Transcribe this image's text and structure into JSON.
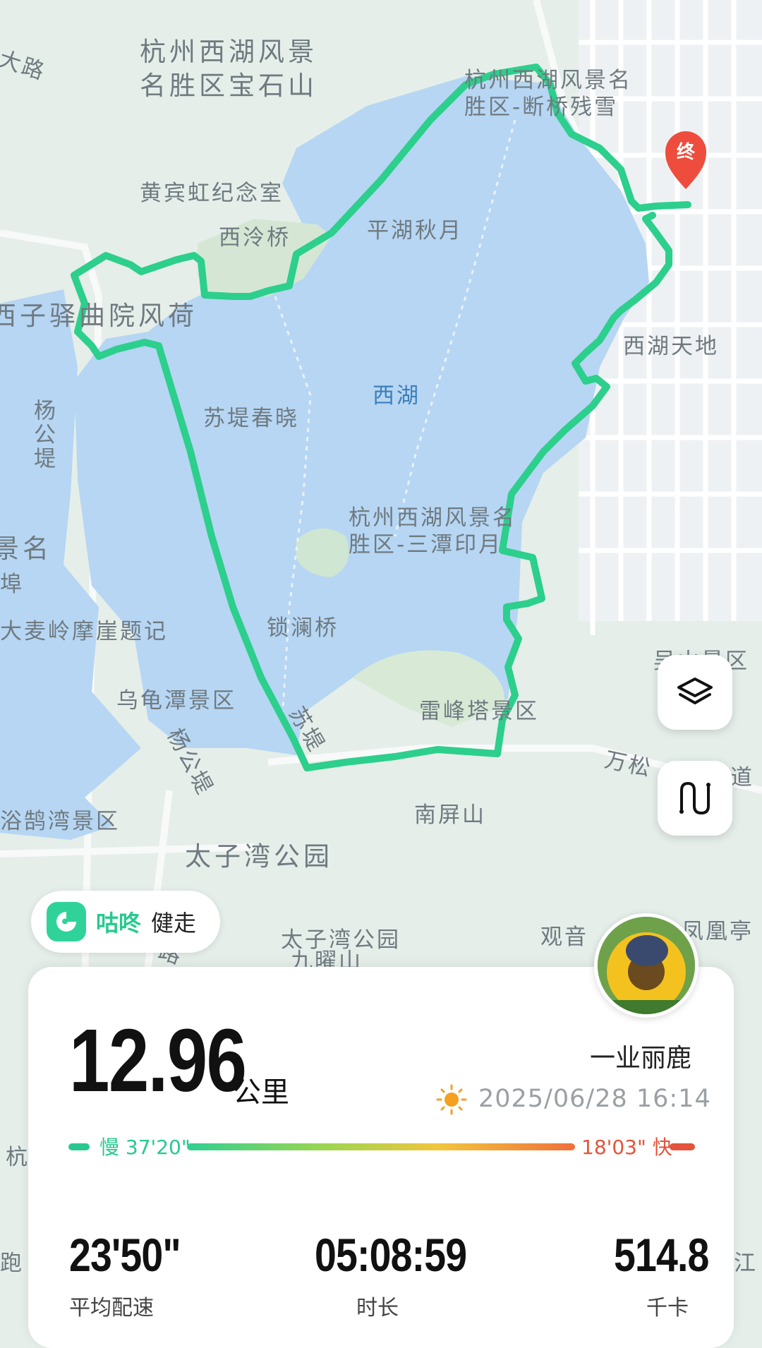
{
  "map": {
    "labels": {
      "big_road": "大路",
      "baoshishan_1": "杭州西湖风景",
      "baoshishan_2": "名胜区宝石山",
      "duanqiao_1": "杭州西湖风景名",
      "duanqiao_2": "胜区-断桥残雪",
      "huangbinhong": "黄宾虹纪念室",
      "xilingqiao": "西泠桥",
      "pinghu": "平湖秋月",
      "quyuan": "西子驿曲院风荷",
      "xihu_tiandi": "西湖天地",
      "xihu": "西湖",
      "yanggongdi_v": "杨公堤",
      "sudi_chunxiao": "苏堤春晓",
      "santan_1": "杭州西湖风景名",
      "santan_2": "胜区-三潭印月",
      "scenic_left_1": "景名",
      "scenic_left_2": "埠",
      "damailing": "大麦岭摩崖题记",
      "suolanqiao": "锁澜桥",
      "wuguitan": "乌龟潭景区",
      "leifeng": "雷峰塔景区",
      "sudi": "苏堤",
      "yanggongdi_diag": "杨公堤",
      "wansong": "万松",
      "wansong_dao": "道",
      "yuhu": "浴鹄湾景区",
      "nanping": "南屏山",
      "taiziwan_big": "太子湾公园",
      "taiziwan_small": "太子湾公园",
      "jiuyao": "九曜山",
      "guanyin": "观音",
      "fenghuangting": "凤凰亭",
      "wushan": "吴山景区",
      "lu": "路",
      "hang": "杭",
      "pao": "跑",
      "jiang": "江"
    },
    "end_marker": "终"
  },
  "colors": {
    "route": "#2ccf8c",
    "lake": "#b6d6f3",
    "land": "#e5eee9",
    "brand": "#27c98e",
    "fast": "#e4533b"
  },
  "buttons": {
    "layers": "layers-icon",
    "route": "route-icon"
  },
  "brand": {
    "name": "咕咚",
    "activity": "健走"
  },
  "summary": {
    "distance": "12.96",
    "distance_unit": "公里",
    "username": "一业丽鹿",
    "weather": "sun-icon",
    "datetime": "2025/06/28 16:14",
    "pace_slow": "慢 37'20\"",
    "pace_fast": "18'03\" 快"
  },
  "stats": [
    {
      "value": "23'50\"",
      "label": "平均配速"
    },
    {
      "value": "05:08:59",
      "label": "时长"
    },
    {
      "value": "514.8",
      "label": "千卡"
    }
  ]
}
